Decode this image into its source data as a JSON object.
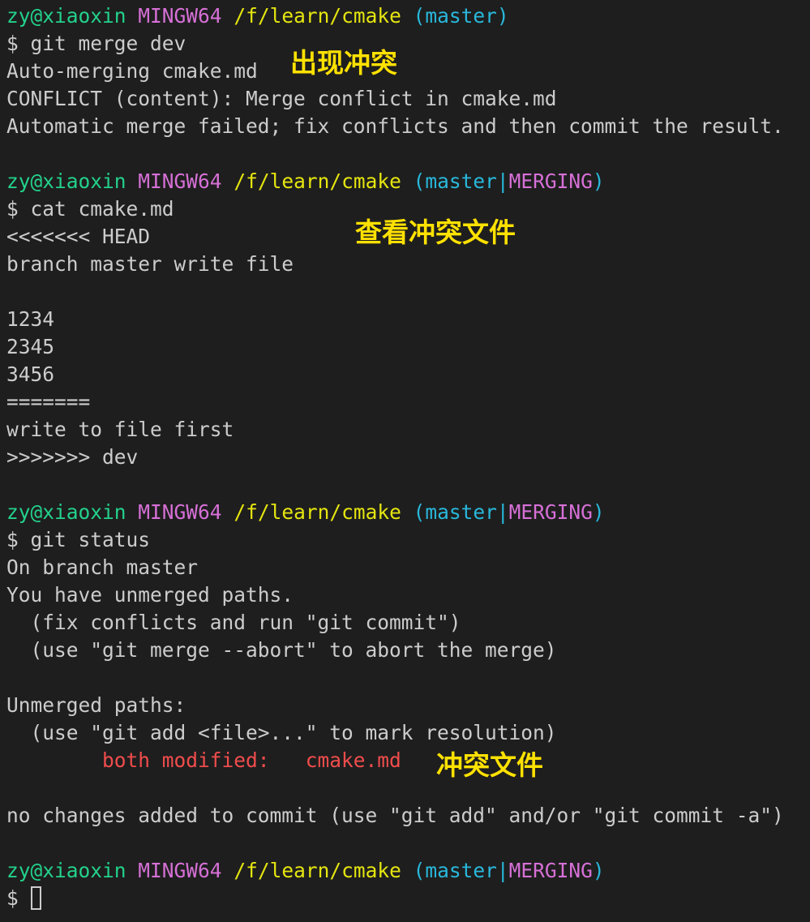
{
  "prompt": {
    "user": "zy@xiaoxin",
    "system": "MINGW64",
    "path": "/f/learn/cmake",
    "branch": "master",
    "state": "MERGING"
  },
  "lines": {
    "l02": "$ git merge dev",
    "l03": "Auto-merging cmake.md",
    "l04": "CONFLICT (content): Merge conflict in cmake.md",
    "l05": "Automatic merge failed; fix conflicts and then commit the result.",
    "l08": "$ cat cmake.md",
    "l09": "<<<<<<< HEAD",
    "l10": "branch master write file",
    "l12": "1234",
    "l13": "2345",
    "l14": "3456",
    "l15": "=======",
    "l16": "write to file first",
    "l17": ">>>>>>> dev",
    "l20": "$ git status",
    "l21": "On branch master",
    "l22": "You have unmerged paths.",
    "l23": "  (fix conflicts and run \"git commit\")",
    "l24": "  (use \"git merge --abort\" to abort the merge)",
    "l26": "Unmerged paths:",
    "l27": "  (use \"git add <file>...\" to mark resolution)",
    "l28_indent": "        ",
    "l28_status": "both modified:   cmake.md",
    "l30": "no changes added to commit (use \"git add\" and/or \"git commit -a\")",
    "l32": "$ "
  },
  "annotations": {
    "conflict": "出现冲突",
    "view_file": "查看冲突文件",
    "conflict_file": "冲突文件"
  }
}
